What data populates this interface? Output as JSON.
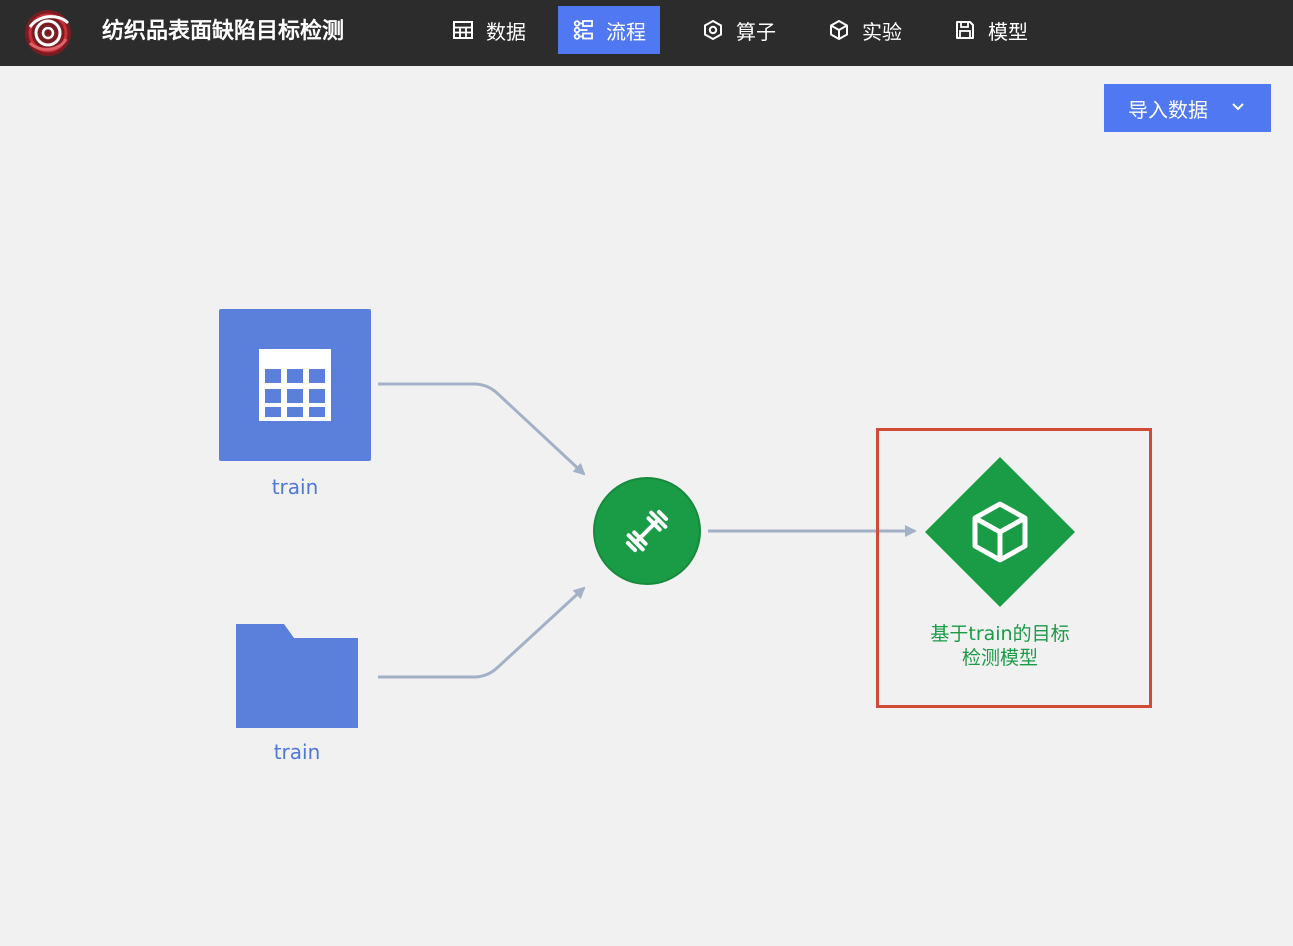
{
  "header": {
    "app_title": "纺织品表面缺陷目标检测",
    "logo_icon": "swirl-logo-icon",
    "nav": [
      {
        "label": "数据",
        "icon": "table-grid-icon",
        "active": false
      },
      {
        "label": "流程",
        "icon": "workflow-icon",
        "active": true
      },
      {
        "label": "算子",
        "icon": "hexagon-icon",
        "active": false
      },
      {
        "label": "实验",
        "icon": "cube-icon",
        "active": false
      },
      {
        "label": "模型",
        "icon": "save-disk-icon",
        "active": false
      }
    ]
  },
  "toolbar": {
    "import_label": "导入数据",
    "import_caret_icon": "chevron-down-icon"
  },
  "flow": {
    "nodes": [
      {
        "id": "table-data",
        "label": "train",
        "type": "dataset-table",
        "icon": "table-grid-icon"
      },
      {
        "id": "folder-data",
        "label": "train",
        "type": "dataset-folder",
        "icon": "folder-icon"
      },
      {
        "id": "trainer",
        "label": "",
        "type": "training-operator",
        "icon": "dumbbell-icon"
      },
      {
        "id": "model",
        "label": "基于train的目标检测模型",
        "label_lines": [
          "基于train的目标",
          "检测模型"
        ],
        "type": "model",
        "icon": "cube-icon",
        "highlighted": true
      }
    ],
    "edges": [
      {
        "from": "table-data",
        "to": "trainer"
      },
      {
        "from": "folder-data",
        "to": "trainer"
      },
      {
        "from": "trainer",
        "to": "model"
      }
    ]
  },
  "colors": {
    "topbar": "#2c2c2c",
    "accent": "#4f78f2",
    "dataset_node": "#5b80dc",
    "operator_green": "#1a9b45",
    "highlight_red": "#d04a34",
    "edge": "#a3b1c6",
    "background": "#f1f1f2"
  }
}
